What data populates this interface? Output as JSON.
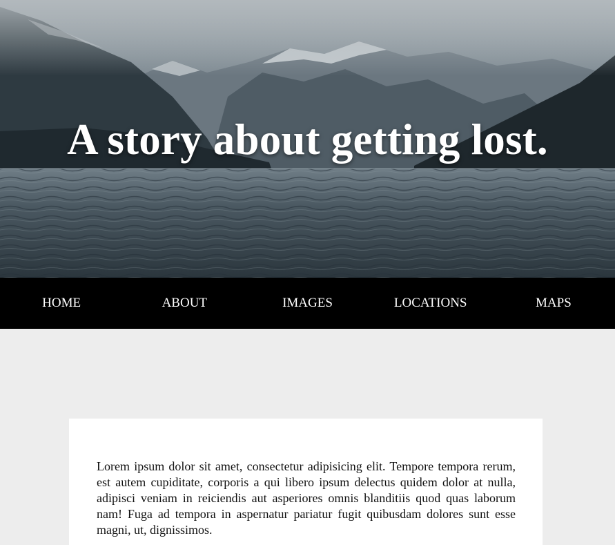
{
  "hero": {
    "title": "A story about getting lost.",
    "background_image": "mountain-lake-landscape"
  },
  "nav": {
    "items": [
      {
        "label": "HOME"
      },
      {
        "label": "ABOUT"
      },
      {
        "label": "IMAGES"
      },
      {
        "label": "LOCATIONS"
      },
      {
        "label": "MAPS"
      }
    ]
  },
  "main": {
    "card": {
      "text": "Lorem ipsum dolor sit amet, consectetur adipisicing elit. Tempore tempora rerum, est autem cupiditate, corporis a qui libero ipsum delectus quidem dolor at nulla, adipisci veniam in reiciendis aut asperiores omnis blanditiis quod quas laborum nam! Fuga ad tempora in aspernatur pariatur fugit quibusdam dolores sunt esse magni, ut, dignissimos."
    }
  },
  "colors": {
    "page_background": "#ededed",
    "nav_background": "#000000",
    "nav_text": "#ffffff",
    "card_background": "#ffffff",
    "hero_title": "#ffffff"
  }
}
